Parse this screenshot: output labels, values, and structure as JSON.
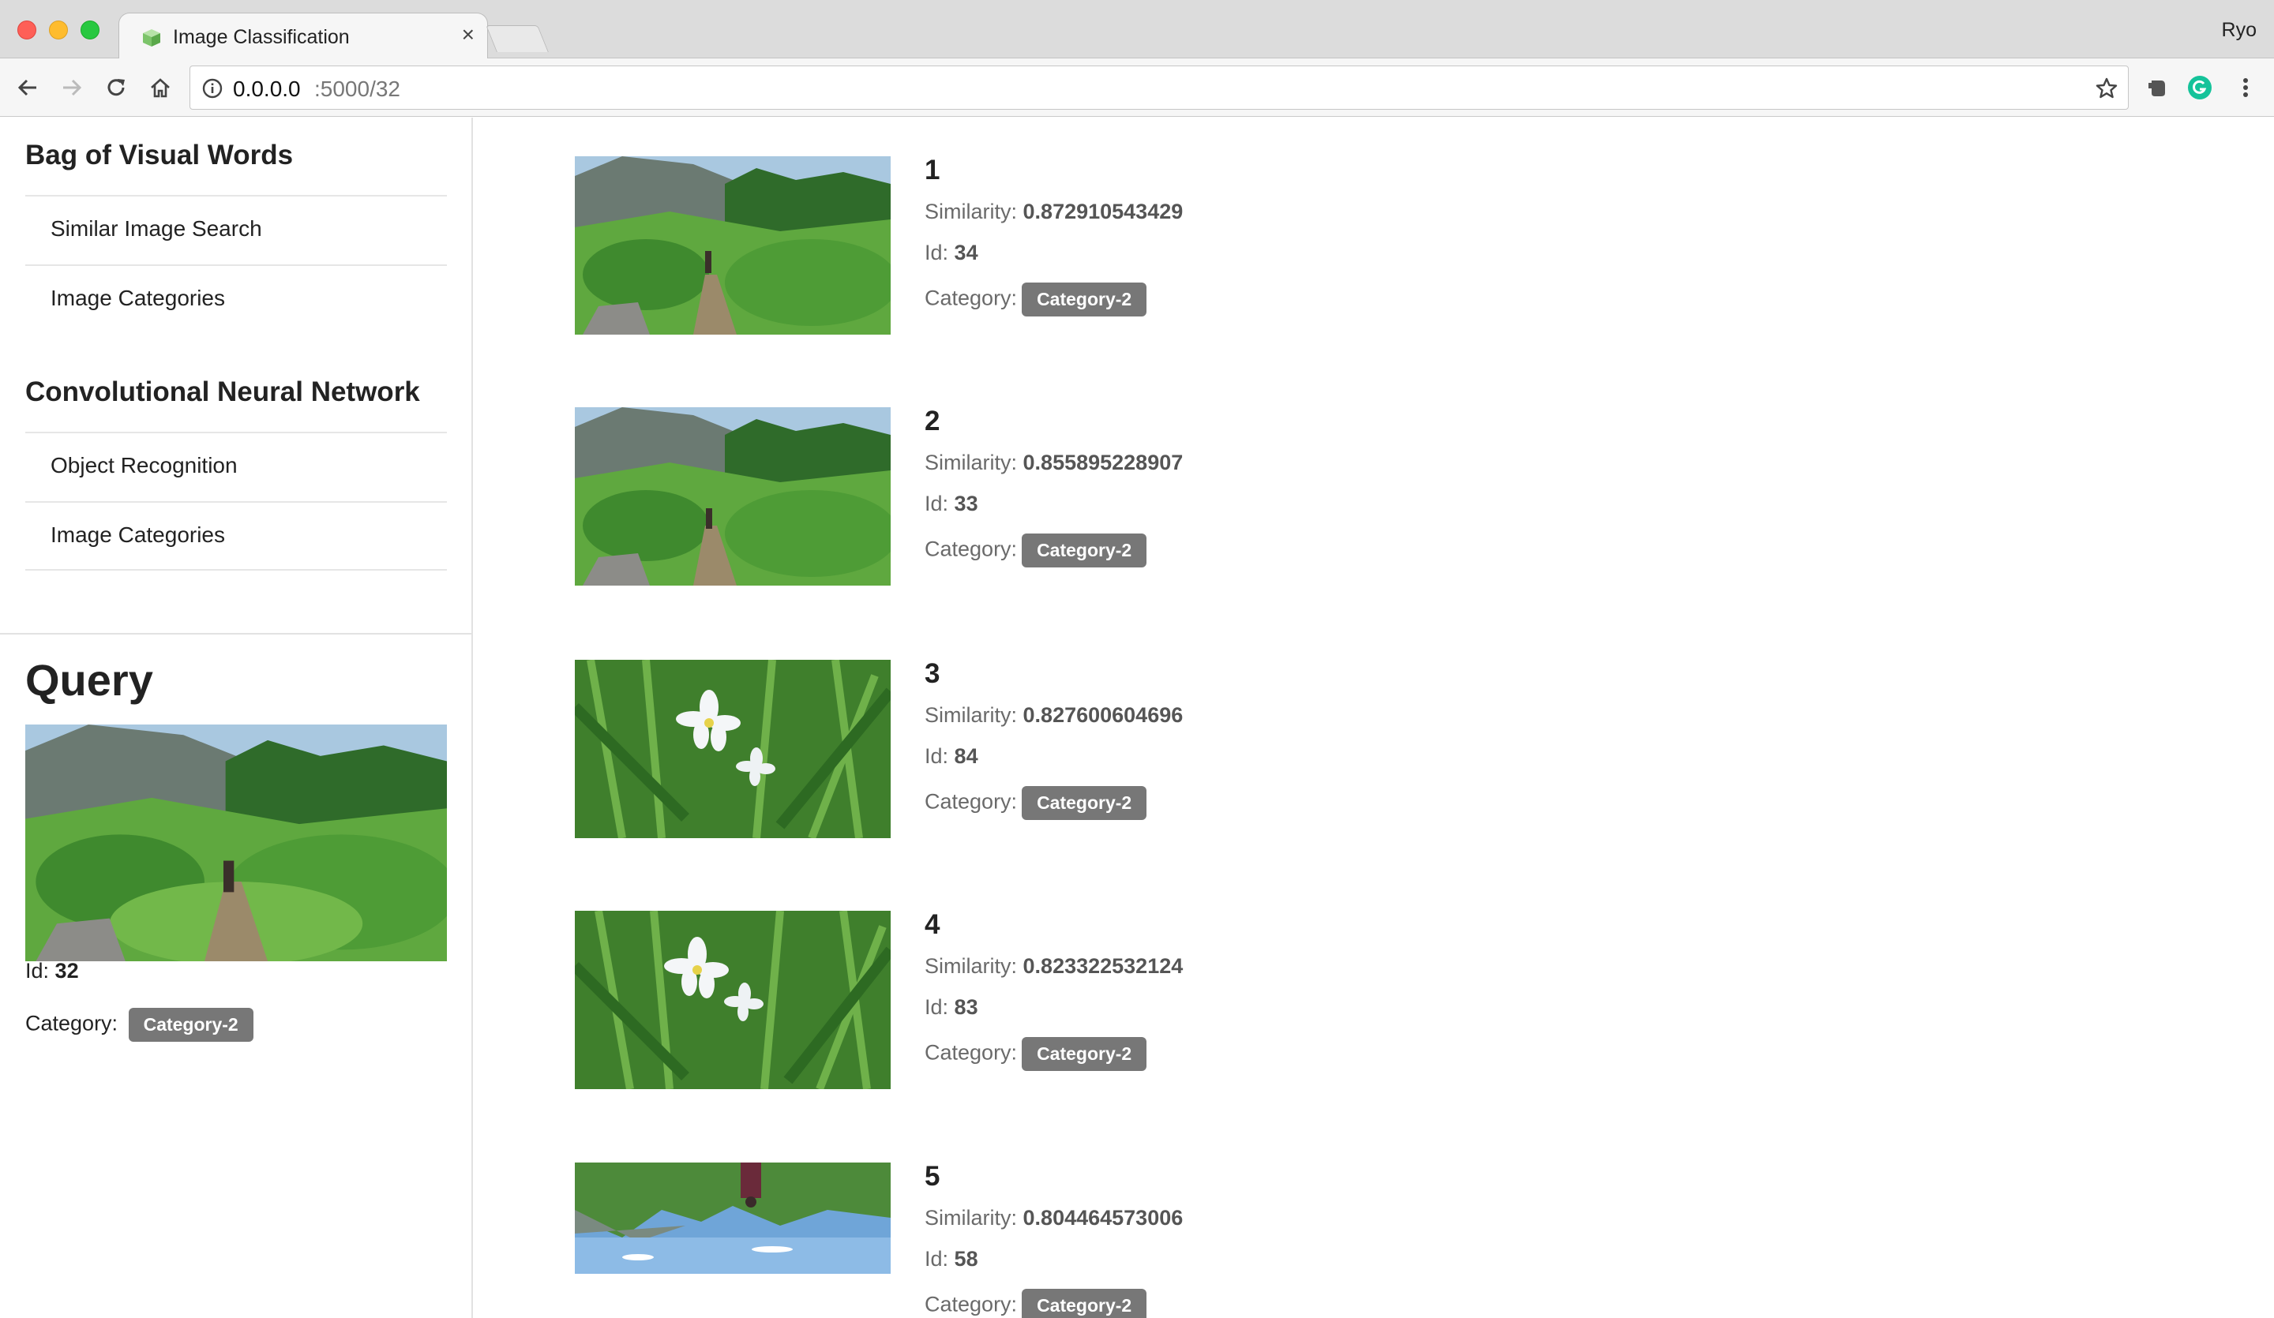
{
  "browser": {
    "tab_title": "Image Classification",
    "tab_close": "×",
    "profile_name": "Ryo",
    "url_host": "0.0.0.0",
    "url_path": ":5000/32"
  },
  "sidebar": {
    "sections": [
      {
        "title": "Bag of Visual Words",
        "items": [
          "Similar Image Search",
          "Image Categories"
        ]
      },
      {
        "title": "Convolutional Neural Network",
        "items": [
          "Object Recognition",
          "Image Categories"
        ]
      }
    ]
  },
  "query": {
    "title": "Query",
    "id_label": "Id:",
    "id": "32",
    "category_label": "Category:",
    "category": "Category-2"
  },
  "labels": {
    "similarity": "Similarity:",
    "id": "Id:",
    "category": "Category:"
  },
  "results": [
    {
      "rank": "1",
      "similarity": "0.872910543429",
      "id": "34",
      "category": "Category-2"
    },
    {
      "rank": "2",
      "similarity": "0.855895228907",
      "id": "33",
      "category": "Category-2"
    },
    {
      "rank": "3",
      "similarity": "0.827600604696",
      "id": "84",
      "category": "Category-2"
    },
    {
      "rank": "4",
      "similarity": "0.823322532124",
      "id": "83",
      "category": "Category-2"
    },
    {
      "rank": "5",
      "similarity": "0.804464573006",
      "id": "58",
      "category": "Category-2"
    }
  ],
  "images": {
    "query": "mountain-trail",
    "results": [
      "mountain-trail",
      "mountain-trail",
      "white-flowers",
      "white-flowers",
      "upside-down-lake"
    ]
  },
  "colors": {
    "badge": "#777777",
    "chrome": "#dcdcdc",
    "grammarly": "#15c39a"
  },
  "icons": {
    "back": "arrow-left-icon",
    "forward": "arrow-right-icon",
    "reload": "reload-icon",
    "home": "home-icon",
    "info": "info-icon",
    "bookmark": "star-icon",
    "evernote": "evernote-icon",
    "grammarly": "grammarly-icon",
    "menu": "kebab-menu-icon"
  }
}
